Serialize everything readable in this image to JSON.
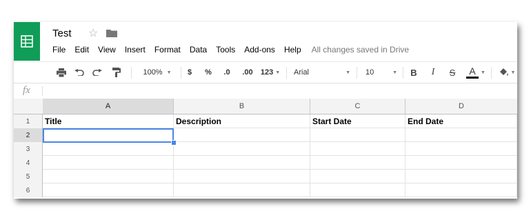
{
  "document": {
    "title": "Test"
  },
  "menu": {
    "items": [
      "File",
      "Edit",
      "View",
      "Insert",
      "Format",
      "Data",
      "Tools",
      "Add-ons",
      "Help"
    ],
    "save_status": "All changes saved in Drive"
  },
  "toolbar": {
    "zoom": "100%",
    "currency": "$",
    "percent": "%",
    "dec_decrease": ".0",
    "dec_increase": ".00",
    "more_formats": "123",
    "font": "Arial",
    "font_size": "10",
    "bold": "B",
    "italic": "I",
    "strikethrough": "S",
    "text_color": "A",
    "text_color_value": "#000000"
  },
  "formula_bar": {
    "label": "fx",
    "value": ""
  },
  "grid": {
    "columns": [
      "A",
      "B",
      "C",
      "D"
    ],
    "rows": [
      {
        "num": "1",
        "cells": [
          "Title",
          "Description",
          "Start Date",
          "End Date"
        ]
      },
      {
        "num": "2",
        "cells": [
          "",
          "",
          "",
          ""
        ]
      },
      {
        "num": "3",
        "cells": [
          "",
          "",
          "",
          ""
        ]
      },
      {
        "num": "4",
        "cells": [
          "",
          "",
          "",
          ""
        ]
      },
      {
        "num": "5",
        "cells": [
          "",
          "",
          "",
          ""
        ]
      },
      {
        "num": "6",
        "cells": [
          "",
          "",
          "",
          ""
        ]
      }
    ],
    "selected_cell": "A2"
  },
  "colors": {
    "brand": "#0f9d58",
    "selection": "#4a86e8"
  }
}
